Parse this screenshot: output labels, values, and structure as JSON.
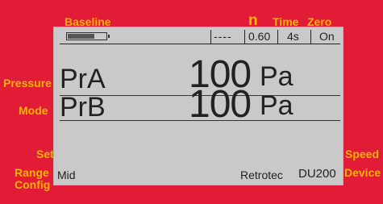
{
  "softkeys": {
    "top": {
      "baseline": "Baseline",
      "n": "n",
      "time": "Time",
      "zero": "Zero"
    },
    "left": {
      "pressure": "Pressure",
      "mode": "Mode",
      "set": "Set",
      "range": "Range",
      "config": "Config"
    },
    "right": {
      "speed": "Speed",
      "device": "Device"
    }
  },
  "status": {
    "battery_level": 0.7,
    "dashes": "----",
    "n_value": "0.60",
    "time_value": "4s",
    "zero_value": "On"
  },
  "channels": [
    {
      "name": "PrA",
      "value": "100",
      "unit": "Pa"
    },
    {
      "name": "PrB",
      "value": "100",
      "unit": "Pa"
    }
  ],
  "footer": {
    "mode": "Mid",
    "brand": "Retrotec",
    "model": "DU200"
  },
  "colors": {
    "bezel": "#e21b37",
    "label": "#ffb400",
    "lcd": "#c9c9c9"
  }
}
